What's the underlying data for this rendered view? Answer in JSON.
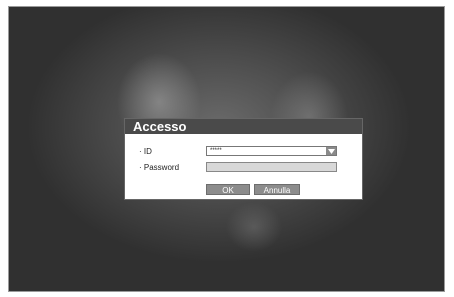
{
  "dialog": {
    "title": "Accesso",
    "id_label": "ID",
    "id_value": "*****",
    "password_label": "Password",
    "password_value": "",
    "ok_label": "OK",
    "cancel_label": "Annulla"
  }
}
